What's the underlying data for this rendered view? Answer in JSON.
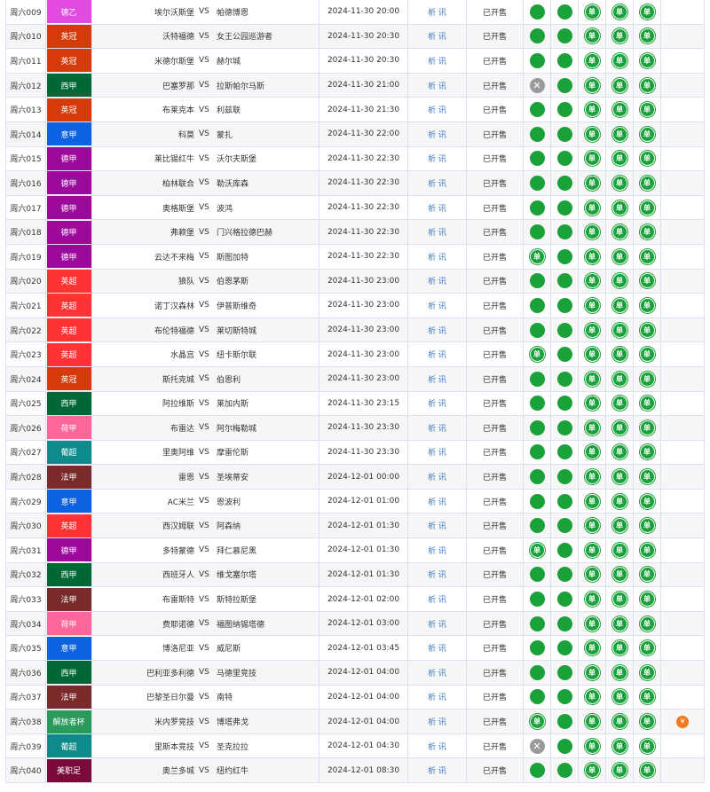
{
  "vs_label": "VS",
  "icons": {
    "single": "单",
    "stop": "✕",
    "gift": "¥"
  },
  "colors": {
    "dot_green": "#1aa13a",
    "dot_stop": "#9a9a9a",
    "link_blue": "#3a79c4",
    "promo_orange": "#f07b1e"
  },
  "rows": [
    {
      "no": "周六009",
      "league": "德乙",
      "color": "#e24be2",
      "home": "埃尔沃斯堡",
      "away": "帕德博恩",
      "time": "2024-11-30 20:00",
      "analysis": "析 讯",
      "status": "已开售",
      "icons": [
        "dot",
        "dot",
        "single",
        "single",
        "single"
      ],
      "extra": ""
    },
    {
      "no": "周六010",
      "league": "英冠",
      "color": "#d53a0a",
      "home": "沃特福德",
      "away": "女王公园巡游者",
      "time": "2024-11-30 20:30",
      "analysis": "析 讯",
      "status": "已开售",
      "icons": [
        "dot",
        "dot",
        "single",
        "single",
        "single"
      ],
      "extra": ""
    },
    {
      "no": "周六011",
      "league": "英冠",
      "color": "#d53a0a",
      "home": "米德尔斯堡",
      "away": "赫尔城",
      "time": "2024-11-30 20:30",
      "analysis": "析 讯",
      "status": "已开售",
      "icons": [
        "dot",
        "dot",
        "single",
        "single",
        "single"
      ],
      "extra": ""
    },
    {
      "no": "周六012",
      "league": "西甲",
      "color": "#006837",
      "home": "巴塞罗那",
      "away": "拉斯帕尔马斯",
      "time": "2024-11-30 21:00",
      "analysis": "析 讯",
      "status": "已开售",
      "icons": [
        "stop",
        "dot",
        "single",
        "single",
        "single"
      ],
      "extra": ""
    },
    {
      "no": "周六013",
      "league": "英冠",
      "color": "#d53a0a",
      "home": "布莱克本",
      "away": "利兹联",
      "time": "2024-11-30 21:30",
      "analysis": "析 讯",
      "status": "已开售",
      "icons": [
        "dot",
        "dot",
        "single",
        "single",
        "single"
      ],
      "extra": ""
    },
    {
      "no": "周六014",
      "league": "意甲",
      "color": "#0c62e0",
      "home": "科莫",
      "away": "蒙扎",
      "time": "2024-11-30 22:00",
      "analysis": "析 讯",
      "status": "已开售",
      "icons": [
        "dot",
        "dot",
        "single",
        "single",
        "single"
      ],
      "extra": ""
    },
    {
      "no": "周六015",
      "league": "德甲",
      "color": "#9c0a9c",
      "home": "莱比锡红牛",
      "away": "沃尔夫斯堡",
      "time": "2024-11-30 22:30",
      "analysis": "析 讯",
      "status": "已开售",
      "icons": [
        "dot",
        "dot",
        "single",
        "single",
        "single"
      ],
      "extra": ""
    },
    {
      "no": "周六016",
      "league": "德甲",
      "color": "#9c0a9c",
      "home": "柏林联合",
      "away": "勒沃库森",
      "time": "2024-11-30 22:30",
      "analysis": "析 讯",
      "status": "已开售",
      "icons": [
        "dot",
        "dot",
        "single",
        "single",
        "single"
      ],
      "extra": ""
    },
    {
      "no": "周六017",
      "league": "德甲",
      "color": "#9c0a9c",
      "home": "奥格斯堡",
      "away": "波鸿",
      "time": "2024-11-30 22:30",
      "analysis": "析 讯",
      "status": "已开售",
      "icons": [
        "dot",
        "dot",
        "single",
        "single",
        "single"
      ],
      "extra": ""
    },
    {
      "no": "周六018",
      "league": "德甲",
      "color": "#9c0a9c",
      "home": "弗赖堡",
      "away": "门兴格拉德巴赫",
      "time": "2024-11-30 22:30",
      "analysis": "析 讯",
      "status": "已开售",
      "icons": [
        "dot",
        "dot",
        "single",
        "single",
        "single"
      ],
      "extra": ""
    },
    {
      "no": "周六019",
      "league": "德甲",
      "color": "#9c0a9c",
      "home": "云达不来梅",
      "away": "斯图加特",
      "time": "2024-11-30 22:30",
      "analysis": "析 讯",
      "status": "已开售",
      "icons": [
        "single",
        "dot",
        "single",
        "single",
        "single"
      ],
      "extra": ""
    },
    {
      "no": "周六020",
      "league": "英超",
      "color": "#ff3333",
      "home": "狼队",
      "away": "伯恩茅斯",
      "time": "2024-11-30 23:00",
      "analysis": "析 讯",
      "status": "已开售",
      "icons": [
        "dot",
        "dot",
        "single",
        "single",
        "single"
      ],
      "extra": ""
    },
    {
      "no": "周六021",
      "league": "英超",
      "color": "#ff3333",
      "home": "诺丁汉森林",
      "away": "伊普斯维奇",
      "time": "2024-11-30 23:00",
      "analysis": "析 讯",
      "status": "已开售",
      "icons": [
        "dot",
        "dot",
        "single",
        "single",
        "single"
      ],
      "extra": ""
    },
    {
      "no": "周六022",
      "league": "英超",
      "color": "#ff3333",
      "home": "布伦特福德",
      "away": "莱切斯特城",
      "time": "2024-11-30 23:00",
      "analysis": "析 讯",
      "status": "已开售",
      "icons": [
        "dot",
        "dot",
        "single",
        "single",
        "single"
      ],
      "extra": ""
    },
    {
      "no": "周六023",
      "league": "英超",
      "color": "#ff3333",
      "home": "水晶宫",
      "away": "纽卡斯尔联",
      "time": "2024-11-30 23:00",
      "analysis": "析 讯",
      "status": "已开售",
      "icons": [
        "single",
        "dot",
        "single",
        "single",
        "single"
      ],
      "extra": ""
    },
    {
      "no": "周六024",
      "league": "英冠",
      "color": "#d53a0a",
      "home": "斯托克城",
      "away": "伯恩利",
      "time": "2024-11-30 23:00",
      "analysis": "析 讯",
      "status": "已开售",
      "icons": [
        "dot",
        "dot",
        "single",
        "single",
        "single"
      ],
      "extra": ""
    },
    {
      "no": "周六025",
      "league": "西甲",
      "color": "#006837",
      "home": "阿拉维斯",
      "away": "莱加内斯",
      "time": "2024-11-30 23:15",
      "analysis": "析 讯",
      "status": "已开售",
      "icons": [
        "dot",
        "dot",
        "single",
        "single",
        "single"
      ],
      "extra": ""
    },
    {
      "no": "周六026",
      "league": "荷甲",
      "color": "#ff6699",
      "home": "布雷达",
      "away": "阿尔梅勒城",
      "time": "2024-11-30 23:30",
      "analysis": "析 讯",
      "status": "已开售",
      "icons": [
        "dot",
        "dot",
        "single",
        "single",
        "single"
      ],
      "extra": ""
    },
    {
      "no": "周六027",
      "league": "葡超",
      "color": "#0f8a8a",
      "home": "里奥阿维",
      "away": "摩雷伦斯",
      "time": "2024-11-30 23:30",
      "analysis": "析 讯",
      "status": "已开售",
      "icons": [
        "dot",
        "dot",
        "single",
        "single",
        "single"
      ],
      "extra": ""
    },
    {
      "no": "周六028",
      "league": "法甲",
      "color": "#7a2a2a",
      "home": "雷恩",
      "away": "圣埃蒂安",
      "time": "2024-12-01 00:00",
      "analysis": "析 讯",
      "status": "已开售",
      "icons": [
        "dot",
        "dot",
        "single",
        "single",
        "single"
      ],
      "extra": ""
    },
    {
      "no": "周六029",
      "league": "意甲",
      "color": "#0c62e0",
      "home": "AC米兰",
      "away": "恩波利",
      "time": "2024-12-01 01:00",
      "analysis": "析 讯",
      "status": "已开售",
      "icons": [
        "dot",
        "dot",
        "single",
        "single",
        "single"
      ],
      "extra": ""
    },
    {
      "no": "周六030",
      "league": "英超",
      "color": "#ff3333",
      "home": "西汉姆联",
      "away": "阿森纳",
      "time": "2024-12-01 01:30",
      "analysis": "析 讯",
      "status": "已开售",
      "icons": [
        "dot",
        "dot",
        "single",
        "single",
        "single"
      ],
      "extra": ""
    },
    {
      "no": "周六031",
      "league": "德甲",
      "color": "#9c0a9c",
      "home": "多特蒙德",
      "away": "拜仁慕尼黑",
      "time": "2024-12-01 01:30",
      "analysis": "析 讯",
      "status": "已开售",
      "icons": [
        "single",
        "dot",
        "single",
        "single",
        "single"
      ],
      "extra": ""
    },
    {
      "no": "周六032",
      "league": "西甲",
      "color": "#006837",
      "home": "西班牙人",
      "away": "维戈塞尔塔",
      "time": "2024-12-01 01:30",
      "analysis": "析 讯",
      "status": "已开售",
      "icons": [
        "dot",
        "dot",
        "single",
        "single",
        "single"
      ],
      "extra": ""
    },
    {
      "no": "周六033",
      "league": "法甲",
      "color": "#7a2a2a",
      "home": "布雷斯特",
      "away": "斯特拉斯堡",
      "time": "2024-12-01 02:00",
      "analysis": "析 讯",
      "status": "已开售",
      "icons": [
        "dot",
        "dot",
        "single",
        "single",
        "single"
      ],
      "extra": ""
    },
    {
      "no": "周六034",
      "league": "荷甲",
      "color": "#ff6699",
      "home": "费耶诺德",
      "away": "福图纳锡塔德",
      "time": "2024-12-01 03:00",
      "analysis": "析 讯",
      "status": "已开售",
      "icons": [
        "dot",
        "dot",
        "single",
        "single",
        "single"
      ],
      "extra": ""
    },
    {
      "no": "周六035",
      "league": "意甲",
      "color": "#0c62e0",
      "home": "博洛尼亚",
      "away": "威尼斯",
      "time": "2024-12-01 03:45",
      "analysis": "析 讯",
      "status": "已开售",
      "icons": [
        "dot",
        "dot",
        "single",
        "single",
        "single"
      ],
      "extra": ""
    },
    {
      "no": "周六036",
      "league": "西甲",
      "color": "#006837",
      "home": "巴利亚多利德",
      "away": "马德里竞技",
      "time": "2024-12-01 04:00",
      "analysis": "析 讯",
      "status": "已开售",
      "icons": [
        "dot",
        "dot",
        "single",
        "single",
        "single"
      ],
      "extra": ""
    },
    {
      "no": "周六037",
      "league": "法甲",
      "color": "#7a2a2a",
      "home": "巴黎圣日尔曼",
      "away": "南特",
      "time": "2024-12-01 04:00",
      "analysis": "析 讯",
      "status": "已开售",
      "icons": [
        "dot",
        "dot",
        "single",
        "single",
        "single"
      ],
      "extra": ""
    },
    {
      "no": "周六038",
      "league": "解放者杯",
      "color": "#2a9a5a",
      "home": "米内罗竞技",
      "away": "博塔弗戈",
      "time": "2024-12-01 04:00",
      "analysis": "析 讯",
      "status": "已开售",
      "icons": [
        "single",
        "dot",
        "single",
        "single",
        "single"
      ],
      "extra": "gift"
    },
    {
      "no": "周六039",
      "league": "葡超",
      "color": "#0f8a8a",
      "home": "里斯本竞技",
      "away": "圣克拉拉",
      "time": "2024-12-01 04:30",
      "analysis": "析 讯",
      "status": "已开售",
      "icons": [
        "stop",
        "dot",
        "single",
        "single",
        "single"
      ],
      "extra": ""
    },
    {
      "no": "周六040",
      "league": "美职足",
      "color": "#7a0a3a",
      "home": "奥兰多城",
      "away": "纽约红牛",
      "time": "2024-12-01 08:30",
      "analysis": "析 讯",
      "status": "已开售",
      "icons": [
        "dot",
        "dot",
        "single",
        "single",
        "single"
      ],
      "extra": ""
    }
  ]
}
